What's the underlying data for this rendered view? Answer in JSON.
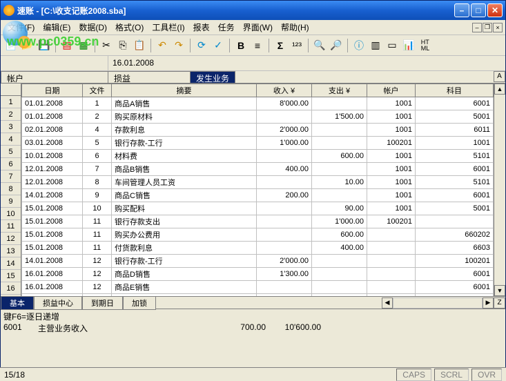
{
  "window": {
    "title": "速账 - [C:\\收支记账2008.sba]"
  },
  "menu": {
    "file": "文件(F)",
    "edit": "编辑(E)",
    "data": "数据(D)",
    "format": "格式(O)",
    "toolbar": "工具栏(I)",
    "report": "报表",
    "task": "任务",
    "interface": "界面(W)",
    "help": "帮助(H)"
  },
  "watermark": "www.pc0359.cn",
  "date_cell": "16.01.2008",
  "tabs": {
    "t1": "帐户",
    "t2": "损益",
    "t3": "发生业务"
  },
  "side_letters": {
    "a": "A",
    "z": "Z"
  },
  "columns": {
    "date": "日期",
    "doc": "文件",
    "desc": "摘要",
    "income": "收入 ¥",
    "expense": "支出 ¥",
    "account": "帐户",
    "subject": "科目"
  },
  "rows": [
    {
      "n": "1",
      "date": "01.01.2008",
      "doc": "1",
      "desc": "商品A销售",
      "in": "8'000.00",
      "out": "",
      "acc": "1001",
      "sub": "6001"
    },
    {
      "n": "2",
      "date": "01.01.2008",
      "doc": "2",
      "desc": "购买原材料",
      "in": "",
      "out": "1'500.00",
      "acc": "1001",
      "sub": "5001"
    },
    {
      "n": "3",
      "date": "02.01.2008",
      "doc": "4",
      "desc": "存款利息",
      "in": "2'000.00",
      "out": "",
      "acc": "1001",
      "sub": "6011"
    },
    {
      "n": "4",
      "date": "03.01.2008",
      "doc": "5",
      "desc": "银行存款-工行",
      "in": "1'000.00",
      "out": "",
      "acc": "100201",
      "sub": "1001"
    },
    {
      "n": "5",
      "date": "10.01.2008",
      "doc": "6",
      "desc": "材料费",
      "in": "",
      "out": "600.00",
      "acc": "1001",
      "sub": "5101"
    },
    {
      "n": "6",
      "date": "12.01.2008",
      "doc": "7",
      "desc": "商品B销售",
      "in": "400.00",
      "out": "",
      "acc": "1001",
      "sub": "6001"
    },
    {
      "n": "7",
      "date": "12.01.2008",
      "doc": "8",
      "desc": "车间管理人员工资",
      "in": "",
      "out": "10.00",
      "acc": "1001",
      "sub": "5101"
    },
    {
      "n": "8",
      "date": "14.01.2008",
      "doc": "9",
      "desc": "商品C销售",
      "in": "200.00",
      "out": "",
      "acc": "1001",
      "sub": "6001"
    },
    {
      "n": "9",
      "date": "15.01.2008",
      "doc": "10",
      "desc": "购买配料",
      "in": "",
      "out": "90.00",
      "acc": "1001",
      "sub": "5001"
    },
    {
      "n": "10",
      "date": "15.01.2008",
      "doc": "11",
      "desc": "银行存款支出",
      "in": "",
      "out": "1'000.00",
      "acc": "100201",
      "sub": ""
    },
    {
      "n": "11",
      "date": "15.01.2008",
      "doc": "11",
      "desc": "购买办公费用",
      "in": "",
      "out": "600.00",
      "acc": "",
      "sub": "660202"
    },
    {
      "n": "12",
      "date": "15.01.2008",
      "doc": "11",
      "desc": "付货款利息",
      "in": "",
      "out": "400.00",
      "acc": "",
      "sub": "6603"
    },
    {
      "n": "13",
      "date": "14.01.2008",
      "doc": "12",
      "desc": "银行存款-工行",
      "in": "2'000.00",
      "out": "",
      "acc": "",
      "sub": "100201"
    },
    {
      "n": "14",
      "date": "16.01.2008",
      "doc": "12",
      "desc": "商品D销售",
      "in": "1'300.00",
      "out": "",
      "acc": "",
      "sub": "6001"
    },
    {
      "n": "15",
      "date": "16.01.2008",
      "doc": "12",
      "desc": "商品E销售",
      "in": "",
      "out": "",
      "acc": "",
      "sub": "6001"
    }
  ],
  "rowcount_extra": "16",
  "btabs": {
    "b1": "基本",
    "b2": "损益中心",
    "b3": "到期日",
    "b4": "加锁"
  },
  "summary": {
    "line1a": "键F6=逐日递增",
    "line2a": "6001",
    "line2b": "主营业务收入",
    "line2c": "700.00",
    "line2d": "10'600.00"
  },
  "status": {
    "pos": "15/18",
    "caps": "CAPS",
    "scrl": "SCRL",
    "ovr": "OVR"
  },
  "htmltxt": "HT\nML"
}
